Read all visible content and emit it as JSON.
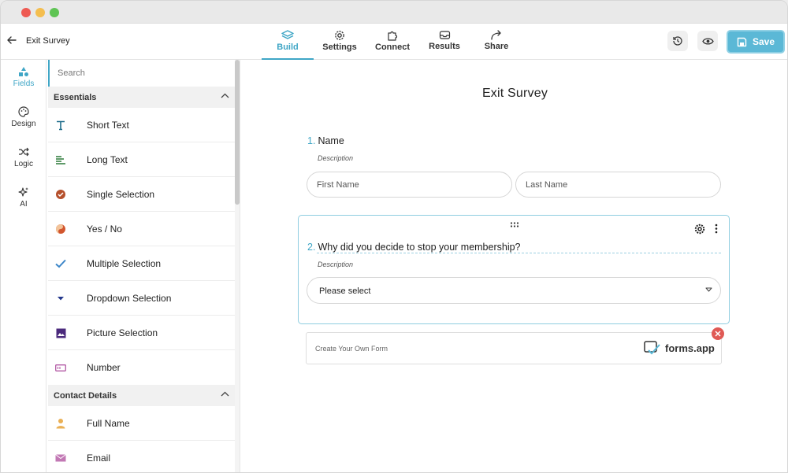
{
  "header": {
    "form_title": "Exit Survey",
    "tabs": [
      {
        "label": "Build",
        "icon": "layers-icon"
      },
      {
        "label": "Settings",
        "icon": "gear-icon"
      },
      {
        "label": "Connect",
        "icon": "puzzle-icon"
      },
      {
        "label": "Results",
        "icon": "inbox-icon"
      },
      {
        "label": "Share",
        "icon": "share-arrow-icon"
      }
    ],
    "save_label": "Save"
  },
  "rail": {
    "items": [
      {
        "label": "Fields",
        "icon": "shapes-icon"
      },
      {
        "label": "Design",
        "icon": "palette-icon"
      },
      {
        "label": "Logic",
        "icon": "shuffle-icon"
      },
      {
        "label": "AI",
        "icon": "sparkles-icon"
      }
    ]
  },
  "panel": {
    "search_placeholder": "Search",
    "sections": [
      {
        "title": "Essentials",
        "items": [
          {
            "label": "Short Text",
            "icon": "text-t-icon"
          },
          {
            "label": "Long Text",
            "icon": "paragraph-lines-icon"
          },
          {
            "label": "Single Selection",
            "icon": "radio-icon"
          },
          {
            "label": "Yes / No",
            "icon": "yes-no-icon"
          },
          {
            "label": "Multiple Selection",
            "icon": "checkmark-icon"
          },
          {
            "label": "Dropdown Selection",
            "icon": "dropdown-caret-icon"
          },
          {
            "label": "Picture Selection",
            "icon": "picture-icon"
          },
          {
            "label": "Number",
            "icon": "number-icon"
          }
        ]
      },
      {
        "title": "Contact Details",
        "items": [
          {
            "label": "Full Name",
            "icon": "person-icon"
          },
          {
            "label": "Email",
            "icon": "envelope-icon"
          }
        ]
      }
    ]
  },
  "canvas": {
    "survey_title": "Exit Survey",
    "q1": {
      "number": "1.",
      "label": "Name",
      "description": "Description",
      "first_placeholder": "First Name",
      "last_placeholder": "Last Name"
    },
    "q2": {
      "number": "2.",
      "label": "Why did you decide to stop your membership?",
      "description": "Description",
      "select_placeholder": "Please select"
    },
    "branding": {
      "cta": "Create Your Own Form",
      "brand_name": "forms.app"
    }
  },
  "colors": {
    "accent": "#3fa6c6",
    "save_button": "#5bb8d6",
    "close_badge": "#e05a55"
  }
}
